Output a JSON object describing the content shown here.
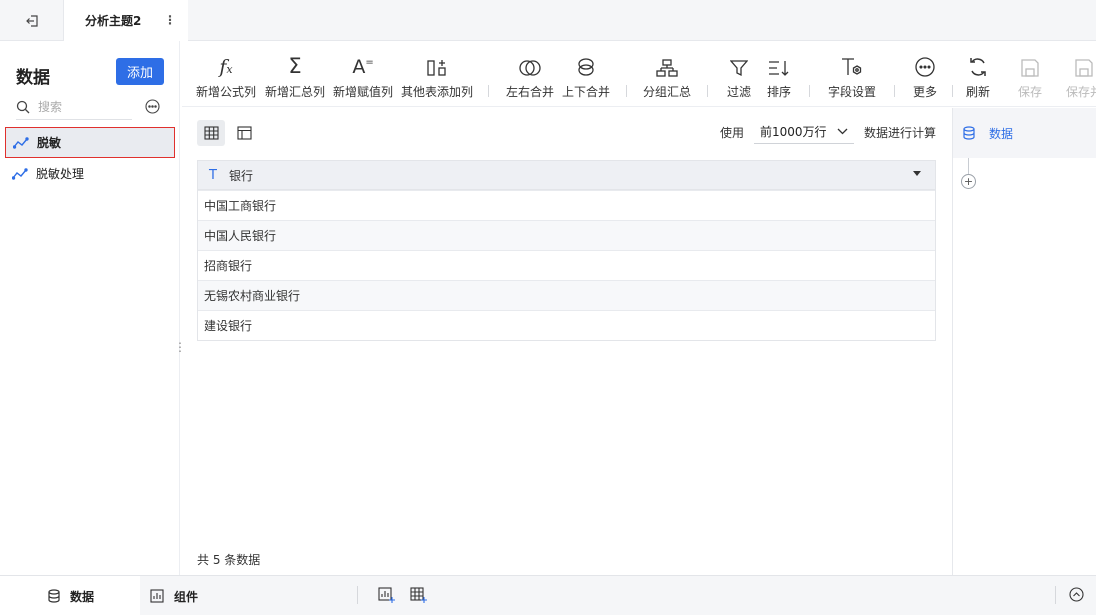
{
  "header": {
    "tab_title": "分析主题2"
  },
  "sidebar": {
    "title": "数据",
    "add_label": "添加",
    "search_placeholder": "搜索",
    "items": [
      {
        "label": "脱敏",
        "active": true
      },
      {
        "label": "脱敏处理",
        "active": false
      }
    ]
  },
  "toolbar": {
    "items": [
      {
        "label": "新增公式列",
        "icon": "formula-icon"
      },
      {
        "label": "新增汇总列",
        "icon": "sigma-icon"
      },
      {
        "label": "新增赋值列",
        "icon": "assign-icon"
      },
      {
        "label": "其他表添加列",
        "icon": "add-column-icon"
      },
      {
        "label": "左右合并",
        "icon": "merge-horizontal-icon"
      },
      {
        "label": "上下合并",
        "icon": "merge-vertical-icon"
      },
      {
        "label": "分组汇总",
        "icon": "group-icon"
      },
      {
        "label": "过滤",
        "icon": "filter-icon"
      },
      {
        "label": "排序",
        "icon": "sort-icon"
      },
      {
        "label": "字段设置",
        "icon": "field-settings-icon"
      },
      {
        "label": "更多",
        "icon": "more-icon"
      },
      {
        "label": "刷新",
        "icon": "refresh-icon"
      },
      {
        "label": "保存",
        "icon": "save-icon",
        "disabled": true
      },
      {
        "label": "保存并",
        "icon": "save-as-icon",
        "disabled": true
      }
    ]
  },
  "calc": {
    "prefix": "使用",
    "selected": "前1000万行",
    "suffix": "数据进行计算"
  },
  "table": {
    "column": "银行",
    "rows": [
      "中国工商银行",
      "中国人民银行",
      "招商银行",
      "无锡农村商业银行",
      "建设银行"
    ],
    "count_text": "共 5 条数据"
  },
  "right_panel": {
    "node_label": "数据"
  },
  "bottom": {
    "tabs": [
      {
        "label": "数据",
        "active": true
      },
      {
        "label": "组件",
        "active": false
      }
    ]
  },
  "colors": {
    "accent": "#2e6ee6",
    "highlight_border": "#e0302d"
  }
}
